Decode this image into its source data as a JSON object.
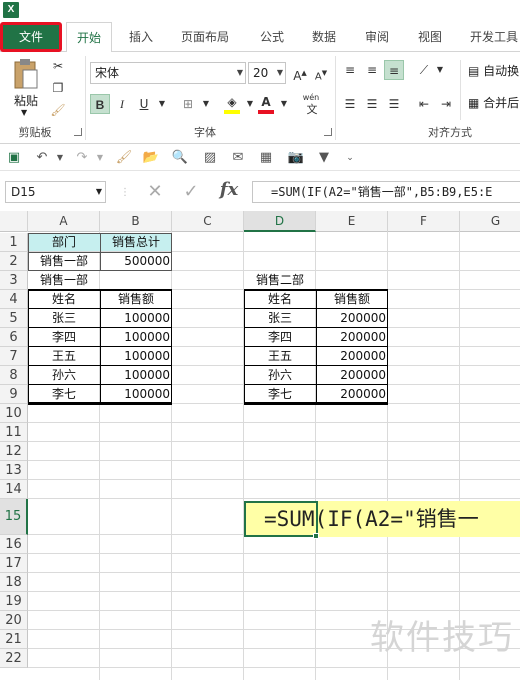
{
  "app": {
    "icon": "excel-icon",
    "icon_text": "X",
    "accent": "#217346",
    "highlight": "#e81123"
  },
  "tabs": [
    "文件",
    "开始",
    "插入",
    "页面布局",
    "公式",
    "数据",
    "审阅",
    "视图",
    "开发工具"
  ],
  "ribbon": {
    "clipboard": {
      "paste_label": "粘贴",
      "group_label": "剪贴板"
    },
    "font": {
      "font_name": "宋体",
      "font_size": "20",
      "bold": "B",
      "italic": "I",
      "underline": "U",
      "phonetic": "wén",
      "group_label": "字体"
    },
    "alignment": {
      "wrap_label": "自动换",
      "merge_label": "合并后",
      "group_label": "对齐方式"
    }
  },
  "formula_bar": {
    "name_box": "D15",
    "cancel": "✕",
    "enter": "✓",
    "fx": "fx",
    "formula": "=SUM(IF(A2=\"销售一部\",B5:B9,E5:E"
  },
  "sheet": {
    "columns": [
      "A",
      "B",
      "C",
      "D",
      "E",
      "F",
      "G"
    ],
    "rows": [
      "1",
      "2",
      "3",
      "4",
      "5",
      "6",
      "7",
      "8",
      "9",
      "10",
      "11",
      "12",
      "13",
      "14",
      "15",
      "16",
      "17",
      "18",
      "19",
      "20",
      "21",
      "22"
    ],
    "selected_column": "D",
    "selected_row": "15",
    "a1": "部门",
    "b1": "销售总计",
    "a2": "销售一部",
    "b2": "500000",
    "a3": "销售一部",
    "d3": "销售二部",
    "dept1": {
      "headers": [
        "姓名",
        "销售额"
      ],
      "rows": [
        [
          "张三",
          "100000"
        ],
        [
          "李四",
          "100000"
        ],
        [
          "王五",
          "100000"
        ],
        [
          "孙六",
          "100000"
        ],
        [
          "李七",
          "100000"
        ]
      ]
    },
    "dept2": {
      "headers": [
        "姓名",
        "销售额"
      ],
      "rows": [
        [
          "张三",
          "200000"
        ],
        [
          "李四",
          "200000"
        ],
        [
          "王五",
          "200000"
        ],
        [
          "孙六",
          "200000"
        ],
        [
          "李七",
          "200000"
        ]
      ]
    },
    "active_cell_text": "=SUM(IF(A2=\"销售一",
    "header_fill": "#c6efef",
    "highlight_fill": "#ffffa6"
  },
  "watermark": "软件技巧"
}
